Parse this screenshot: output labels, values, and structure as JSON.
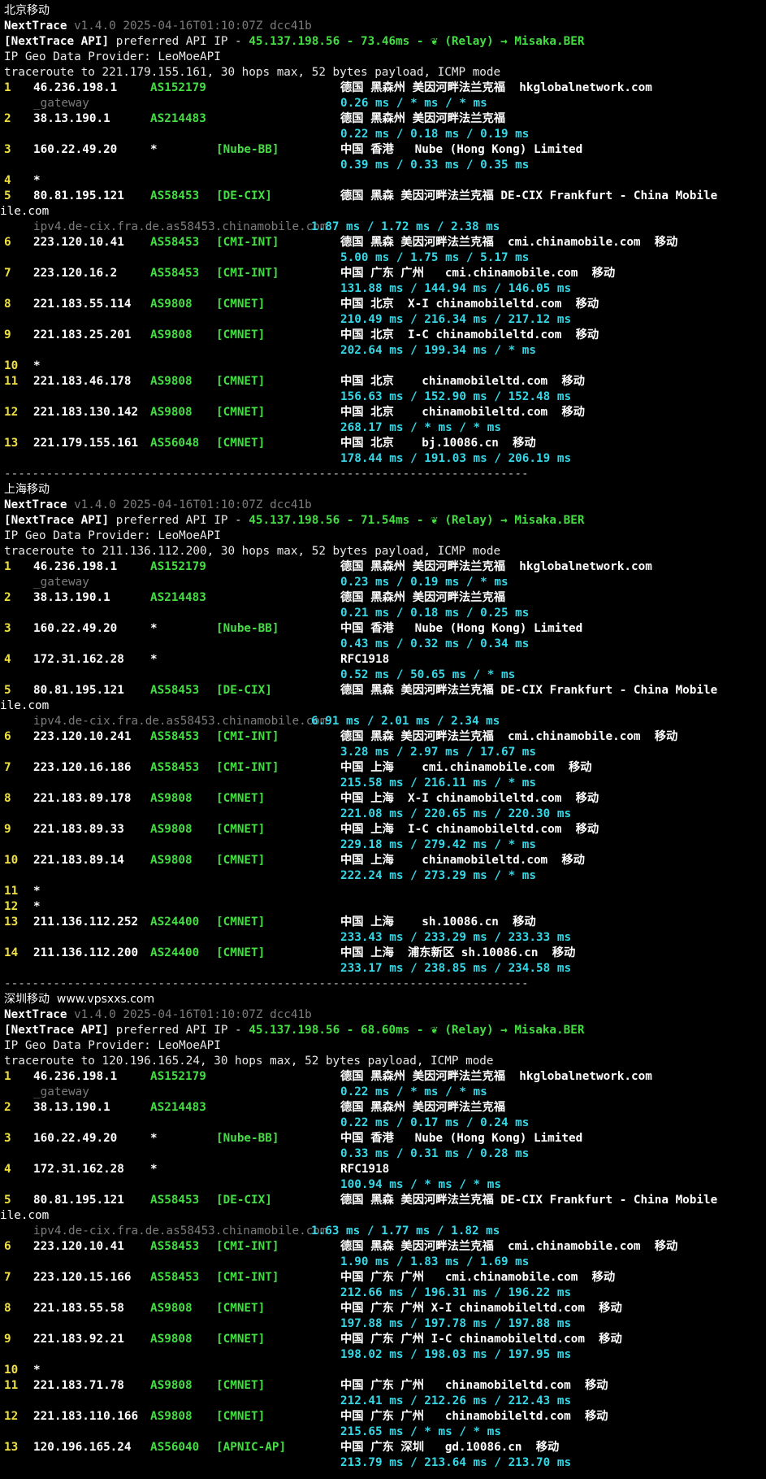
{
  "colors": {
    "hop": "#f0e040",
    "as": "#44dd44",
    "rtt": "#36d7e6",
    "dim": "#7c7c7c",
    "sep": "#bdbdbd",
    "bg": "#000000"
  },
  "separator": "---------------------------------------------------------------------------",
  "header_common": {
    "app": "NextTrace",
    "version": "v1.4.0 2025-04-16T01:10:07Z dcc41b",
    "api_label": "[NextTrace API]",
    "api_text": " preferred API IP - ",
    "api_ip": "45.137.198.56",
    "relay_icon": "leaf-icon",
    "relay": "(Relay) → Misaka.BER",
    "geo_provider": "IP Geo Data Provider: LeoMoeAPI"
  },
  "sections": [
    {
      "title": "北京移动",
      "watermark": "",
      "latency": " - 73.46ms - ",
      "traceroute": "traceroute to 221.179.155.161, 30 hops max, 52 bytes payload, ICMP mode",
      "hops": [
        {
          "n": "1",
          "ip": "46.236.198.1",
          "asn": "AS152179",
          "tag": "",
          "geo": "德国 黑森州 美因河畔法兰克福  hkglobalnetwork.com",
          "rtt": "0.26 ms / * ms / * ms",
          "sub": "_gateway"
        },
        {
          "n": "2",
          "ip": "38.13.190.1",
          "asn": "AS214483",
          "tag": "",
          "geo": "德国 黑森州 美因河畔法兰克福",
          "rtt": "0.22 ms / 0.18 ms / 0.19 ms"
        },
        {
          "n": "3",
          "ip": "160.22.49.20",
          "asn": "*",
          "tag": "[Nube-BB]",
          "geo": "中国 香港   Nube (Hong Kong) Limited",
          "rtt": "0.39 ms / 0.33 ms / 0.35 ms"
        },
        {
          "n": "4",
          "ip": "*"
        },
        {
          "n": "5",
          "ip": "80.81.195.121",
          "asn": "AS58453",
          "tag": "[DE-CIX]",
          "geo": "德国 黑森 美因河畔法兰克福 DE-CIX Frankfurt - China Mobile",
          "wrap": "ile.com",
          "sub": "ipv4.de-cix.fra.de.as58453.chinamobile.com",
          "subrtt": "1.87 ms / 1.72 ms / 2.38 ms"
        },
        {
          "n": "6",
          "ip": "223.120.10.41",
          "asn": "AS58453",
          "tag": "[CMI-INT]",
          "geo": "德国 黑森 美因河畔法兰克福  cmi.chinamobile.com  移动",
          "rtt": "5.00 ms / 1.75 ms / 5.17 ms"
        },
        {
          "n": "7",
          "ip": "223.120.16.2",
          "asn": "AS58453",
          "tag": "[CMI-INT]",
          "geo": "中国 广东 广州   cmi.chinamobile.com  移动",
          "rtt": "131.88 ms / 144.94 ms / 146.05 ms"
        },
        {
          "n": "8",
          "ip": "221.183.55.114",
          "asn": "AS9808",
          "tag": "[CMNET]",
          "geo": "中国 北京  X-I chinamobileltd.com  移动",
          "rtt": "210.49 ms / 216.34 ms / 217.12 ms"
        },
        {
          "n": "9",
          "ip": "221.183.25.201",
          "asn": "AS9808",
          "tag": "[CMNET]",
          "geo": "中国 北京  I-C chinamobileltd.com  移动",
          "rtt": "202.64 ms / 199.34 ms / * ms"
        },
        {
          "n": "10",
          "ip": "*"
        },
        {
          "n": "11",
          "ip": "221.183.46.178",
          "asn": "AS9808",
          "tag": "[CMNET]",
          "geo": "中国 北京    chinamobileltd.com  移动",
          "rtt": "156.63 ms / 152.90 ms / 152.48 ms"
        },
        {
          "n": "12",
          "ip": "221.183.130.142",
          "asn": "AS9808",
          "tag": "[CMNET]",
          "geo": "中国 北京    chinamobileltd.com  移动",
          "rtt": "268.17 ms / * ms / * ms"
        },
        {
          "n": "13",
          "ip": "221.179.155.161",
          "asn": "AS56048",
          "tag": "[CMNET]",
          "geo": "中国 北京    bj.10086.cn  移动",
          "rtt": "178.44 ms / 191.03 ms / 206.19 ms"
        }
      ]
    },
    {
      "title": "上海移动",
      "watermark": "",
      "latency": " - 71.54ms - ",
      "traceroute": "traceroute to 211.136.112.200, 30 hops max, 52 bytes payload, ICMP mode",
      "hops": [
        {
          "n": "1",
          "ip": "46.236.198.1",
          "asn": "AS152179",
          "tag": "",
          "geo": "德国 黑森州 美因河畔法兰克福  hkglobalnetwork.com",
          "rtt": "0.23 ms / 0.19 ms / * ms",
          "sub": "_gateway"
        },
        {
          "n": "2",
          "ip": "38.13.190.1",
          "asn": "AS214483",
          "tag": "",
          "geo": "德国 黑森州 美因河畔法兰克福",
          "rtt": "0.21 ms / 0.18 ms / 0.25 ms"
        },
        {
          "n": "3",
          "ip": "160.22.49.20",
          "asn": "*",
          "tag": "[Nube-BB]",
          "geo": "中国 香港   Nube (Hong Kong) Limited",
          "rtt": "0.43 ms / 0.32 ms / 0.34 ms"
        },
        {
          "n": "4",
          "ip": "172.31.162.28",
          "asn": "*",
          "tag": "",
          "geo": "RFC1918",
          "rtt": "0.52 ms / 50.65 ms / * ms"
        },
        {
          "n": "5",
          "ip": "80.81.195.121",
          "asn": "AS58453",
          "tag": "[DE-CIX]",
          "geo": "德国 黑森 美因河畔法兰克福 DE-CIX Frankfurt - China Mobile",
          "wrap": "ile.com",
          "sub": "ipv4.de-cix.fra.de.as58453.chinamobile.com",
          "subrtt": "6.91 ms / 2.01 ms / 2.34 ms"
        },
        {
          "n": "6",
          "ip": "223.120.10.241",
          "asn": "AS58453",
          "tag": "[CMI-INT]",
          "geo": "德国 黑森 美因河畔法兰克福  cmi.chinamobile.com  移动",
          "rtt": "3.28 ms / 2.97 ms / 17.67 ms"
        },
        {
          "n": "7",
          "ip": "223.120.16.186",
          "asn": "AS58453",
          "tag": "[CMI-INT]",
          "geo": "中国 上海    cmi.chinamobile.com  移动",
          "rtt": "215.58 ms / 216.11 ms / * ms"
        },
        {
          "n": "8",
          "ip": "221.183.89.178",
          "asn": "AS9808",
          "tag": "[CMNET]",
          "geo": "中国 上海  X-I chinamobileltd.com  移动",
          "rtt": "221.08 ms / 220.65 ms / 220.30 ms"
        },
        {
          "n": "9",
          "ip": "221.183.89.33",
          "asn": "AS9808",
          "tag": "[CMNET]",
          "geo": "中国 上海  I-C chinamobileltd.com  移动",
          "rtt": "229.18 ms / 279.42 ms / * ms"
        },
        {
          "n": "10",
          "ip": "221.183.89.14",
          "asn": "AS9808",
          "tag": "[CMNET]",
          "geo": "中国 上海    chinamobileltd.com  移动",
          "rtt": "222.24 ms / 273.29 ms / * ms"
        },
        {
          "n": "11",
          "ip": "*"
        },
        {
          "n": "12",
          "ip": "*"
        },
        {
          "n": "13",
          "ip": "211.136.112.252",
          "asn": "AS24400",
          "tag": "[CMNET]",
          "geo": "中国 上海    sh.10086.cn  移动",
          "rtt": "233.43 ms / 233.29 ms / 233.33 ms"
        },
        {
          "n": "14",
          "ip": "211.136.112.200",
          "asn": "AS24400",
          "tag": "[CMNET]",
          "geo": "中国 上海  浦东新区 sh.10086.cn  移动",
          "rtt": "233.17 ms / 238.85 ms / 234.58 ms"
        }
      ]
    },
    {
      "title": "深圳移动",
      "watermark": "www.vpsxxs.com",
      "latency": " - 68.60ms - ",
      "traceroute": "traceroute to 120.196.165.24, 30 hops max, 52 bytes payload, ICMP mode",
      "hops": [
        {
          "n": "1",
          "ip": "46.236.198.1",
          "asn": "AS152179",
          "tag": "",
          "geo": "德国 黑森州 美因河畔法兰克福  hkglobalnetwork.com",
          "rtt": "0.22 ms / * ms / * ms",
          "sub": "_gateway"
        },
        {
          "n": "2",
          "ip": "38.13.190.1",
          "asn": "AS214483",
          "tag": "",
          "geo": "德国 黑森州 美因河畔法兰克福",
          "rtt": "0.22 ms / 0.17 ms / 0.24 ms"
        },
        {
          "n": "3",
          "ip": "160.22.49.20",
          "asn": "*",
          "tag": "[Nube-BB]",
          "geo": "中国 香港   Nube (Hong Kong) Limited",
          "rtt": "0.33 ms / 0.31 ms / 0.28 ms"
        },
        {
          "n": "4",
          "ip": "172.31.162.28",
          "asn": "*",
          "tag": "",
          "geo": "RFC1918",
          "rtt": "100.94 ms / * ms / * ms"
        },
        {
          "n": "5",
          "ip": "80.81.195.121",
          "asn": "AS58453",
          "tag": "[DE-CIX]",
          "geo": "德国 黑森 美因河畔法兰克福 DE-CIX Frankfurt - China Mobile",
          "wrap": "ile.com",
          "sub": "ipv4.de-cix.fra.de.as58453.chinamobile.com",
          "subrtt": "1.63 ms / 1.77 ms / 1.82 ms"
        },
        {
          "n": "6",
          "ip": "223.120.10.41",
          "asn": "AS58453",
          "tag": "[CMI-INT]",
          "geo": "德国 黑森 美因河畔法兰克福  cmi.chinamobile.com  移动",
          "rtt": "1.90 ms / 1.83 ms / 1.69 ms"
        },
        {
          "n": "7",
          "ip": "223.120.15.166",
          "asn": "AS58453",
          "tag": "[CMI-INT]",
          "geo": "中国 广东 广州   cmi.chinamobile.com  移动",
          "rtt": "212.66 ms / 196.31 ms / 196.22 ms"
        },
        {
          "n": "8",
          "ip": "221.183.55.58",
          "asn": "AS9808",
          "tag": "[CMNET]",
          "geo": "中国 广东 广州 X-I chinamobileltd.com  移动",
          "rtt": "197.88 ms / 197.78 ms / 197.88 ms"
        },
        {
          "n": "9",
          "ip": "221.183.92.21",
          "asn": "AS9808",
          "tag": "[CMNET]",
          "geo": "中国 广东 广州 I-C chinamobileltd.com  移动",
          "rtt": "198.02 ms / 198.03 ms / 197.95 ms"
        },
        {
          "n": "10",
          "ip": "*"
        },
        {
          "n": "11",
          "ip": "221.183.71.78",
          "asn": "AS9808",
          "tag": "[CMNET]",
          "geo": "中国 广东 广州   chinamobileltd.com  移动",
          "rtt": "212.41 ms / 212.26 ms / 212.43 ms"
        },
        {
          "n": "12",
          "ip": "221.183.110.166",
          "asn": "AS9808",
          "tag": "[CMNET]",
          "geo": "中国 广东 广州   chinamobileltd.com  移动",
          "rtt": "215.65 ms / * ms / * ms"
        },
        {
          "n": "13",
          "ip": "120.196.165.24",
          "asn": "AS56040",
          "tag": "[APNIC-AP]",
          "geo": "中国 广东 深圳   gd.10086.cn  移动",
          "rtt": "213.79 ms / 213.64 ms / 213.70 ms"
        }
      ]
    }
  ]
}
